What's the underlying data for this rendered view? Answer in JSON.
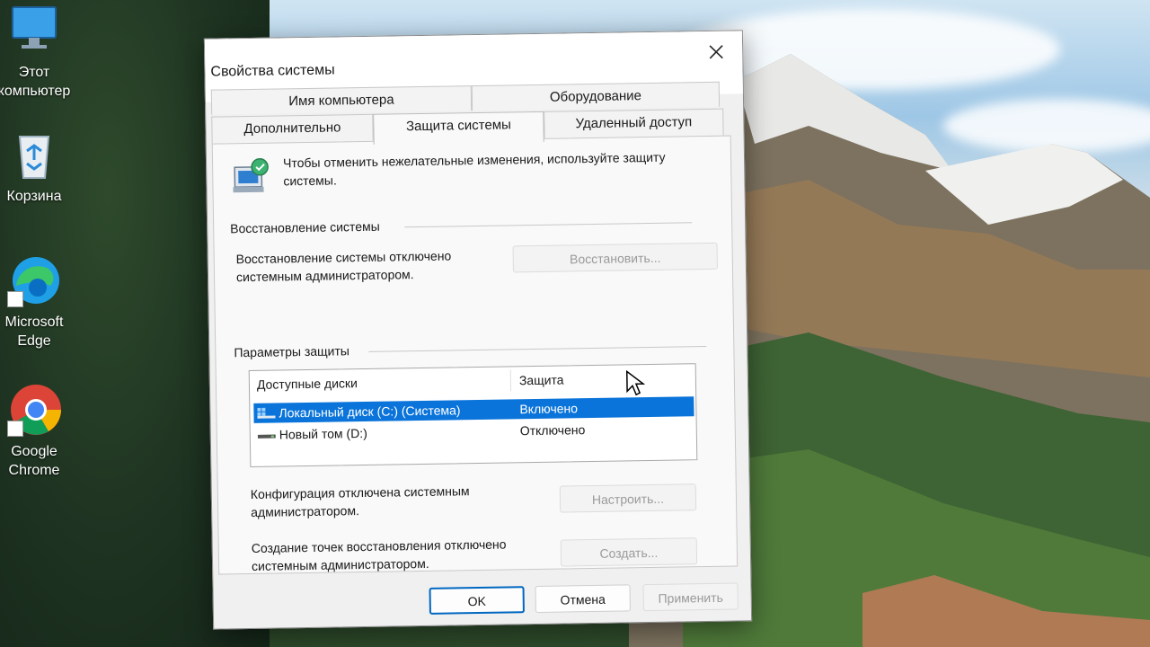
{
  "desktop": {
    "icons": [
      {
        "label": "Этот\nкомпьютер"
      },
      {
        "label": "Корзина"
      },
      {
        "label": "Microsoft\nEdge"
      },
      {
        "label": "Google\nChrome"
      }
    ]
  },
  "dialog": {
    "title": "Свойства системы",
    "tabs": {
      "computer_name": "Имя компьютера",
      "hardware": "Оборудование",
      "advanced": "Дополнительно",
      "system_protection": "Защита системы",
      "remote": "Удаленный доступ"
    },
    "intro_text": "Чтобы отменить нежелательные изменения, используйте защиту системы.",
    "restore_group": {
      "label": "Восстановление системы",
      "status_text": "Восстановление системы отключено системным администратором.",
      "restore_button": "Восстановить..."
    },
    "protection_group": {
      "label": "Параметры защиты",
      "columns": [
        "Доступные диски",
        "Защита"
      ],
      "drives": [
        {
          "name": "Локальный диск (C:) (Система)",
          "protection": "Включено",
          "selected": true
        },
        {
          "name": "Новый том (D:)",
          "protection": "Отключено",
          "selected": false
        }
      ],
      "config_text": "Конфигурация отключена системным администратором.",
      "configure_button": "Настроить...",
      "create_text": "Создание точек восстановления отключено системным администратором.",
      "create_button": "Создать..."
    },
    "buttons": {
      "ok": "OK",
      "cancel": "Отмена",
      "apply": "Применить"
    }
  },
  "colors": {
    "selection": "#0a74da",
    "default_button_border": "#0067c0"
  }
}
